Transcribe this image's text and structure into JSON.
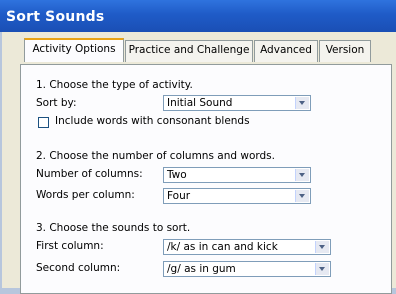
{
  "window": {
    "title": "Sort Sounds"
  },
  "tabs": [
    {
      "label": "Activity Options"
    },
    {
      "label": "Practice and Challenge"
    },
    {
      "label": "Advanced"
    },
    {
      "label": "Version"
    }
  ],
  "section1": {
    "heading": "1.  Choose the type of activity.",
    "sort_by_label": "Sort by:",
    "sort_by_value": "Initial Sound",
    "blends_label": "Include words with consonant blends",
    "blends_checked": false
  },
  "section2": {
    "heading": "2.  Choose the number of columns and words.",
    "columns_label": "Number of columns:",
    "columns_value": "Two",
    "words_label": "Words per column:",
    "words_value": "Four"
  },
  "section3": {
    "heading": "3.  Choose the sounds to sort.",
    "first_label": "First column:",
    "first_value": "/k/ as in can and kick",
    "second_label": "Second column:",
    "second_value": "/g/ as in gum"
  }
}
